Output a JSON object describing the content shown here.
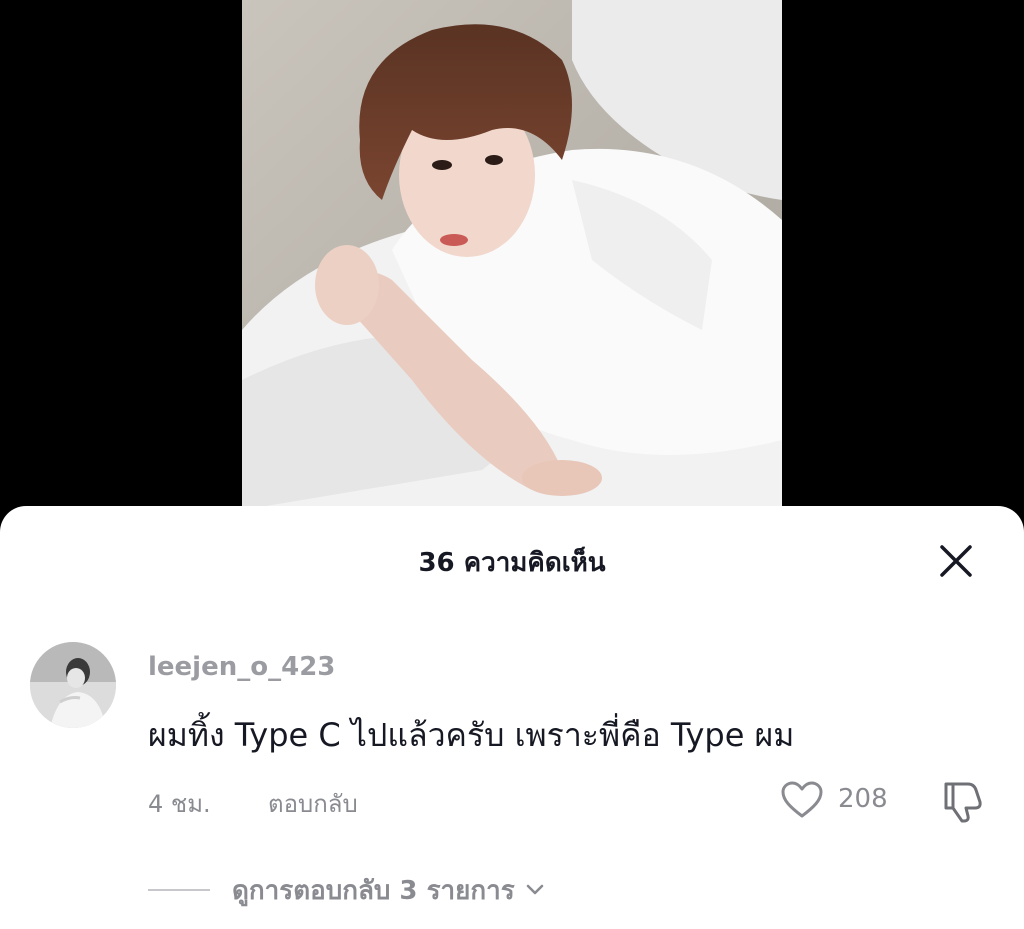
{
  "sheet": {
    "title": "36 ความคิดเห็น",
    "close_icon": "close-icon"
  },
  "comment": {
    "username": "leejen_o_423",
    "text": "ผมทิ้ง Type C ไปแล้วครับ เพราะพี่คือ Type ผม",
    "time": "4 ชม.",
    "reply_label": "ตอบกลับ",
    "like_count": "208",
    "like_icon": "heart-outline-icon",
    "dislike_icon": "thumbs-down-icon"
  },
  "replies": {
    "label": "ดูการตอบกลับ 3 รายการ",
    "chevron_icon": "chevron-down-icon"
  },
  "colors": {
    "sheet_bg": "#ffffff",
    "primary_text": "#161823",
    "secondary_text": "#8a8b91",
    "backdrop": "#000000"
  }
}
